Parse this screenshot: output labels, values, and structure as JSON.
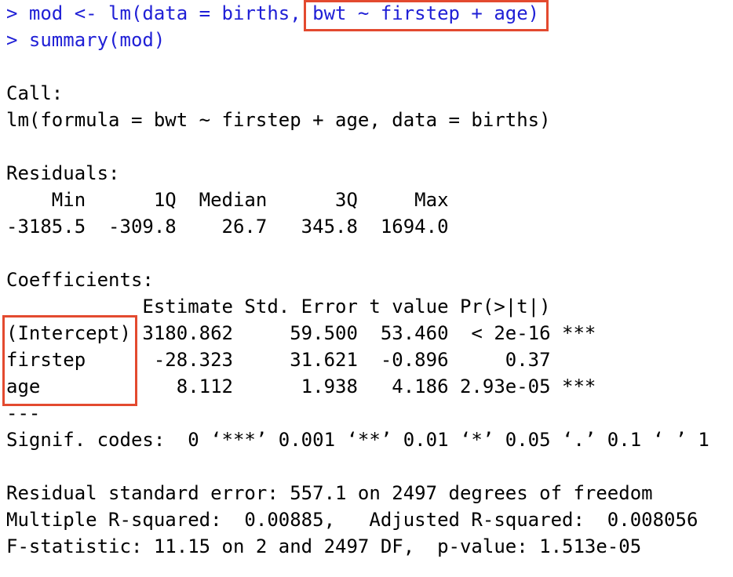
{
  "console": {
    "prompt": ">",
    "input_lines": [
      "mod <- lm(data = births, bwt ~ firstep + age)",
      "summary(mod)"
    ],
    "call_header": "Call:",
    "call_text": "lm(formula = bwt ~ firstep + age, data = births)",
    "residuals_header": "Residuals:",
    "residuals_labels": "    Min      1Q  Median      3Q     Max ",
    "residuals_values": "-3185.5  -309.8    26.7   345.8  1694.0 ",
    "coefficients_header": "Coefficients:",
    "coef_table_header": "            Estimate Std. Error t value Pr(>|t|)    ",
    "coef_rows": [
      "(Intercept) 3180.862     59.500  53.460  < 2e-16 ***",
      "firstep      -28.323     31.621  -0.896     0.37    ",
      "age            8.112      1.938   4.186 2.93e-05 ***"
    ],
    "separator": "---",
    "signif_codes": "Signif. codes:  0 ‘***’ 0.001 ‘**’ 0.01 ‘*’ 0.05 ‘.’ 0.1 ‘ ’ 1",
    "rse_line": "Residual standard error: 557.1 on 2497 degrees of freedom",
    "r2_line": "Multiple R-squared:  0.00885,\tAdjusted R-squared:  0.008056 ",
    "f_line": "F-statistic: 11.15 on 2 and 2497 DF,  p-value: 1.513e-05"
  },
  "colors": {
    "input_text": "#1f1fd6",
    "output_text": "#000000",
    "highlight_box": "#e34a2f"
  }
}
